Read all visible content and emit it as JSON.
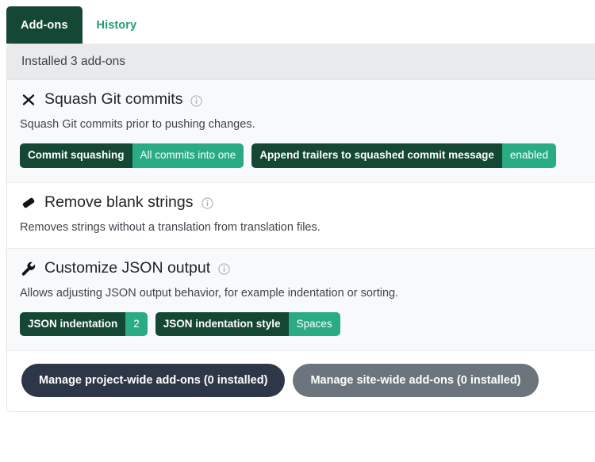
{
  "tabs": [
    {
      "label": "Add-ons",
      "active": true,
      "name": "tab-addons"
    },
    {
      "label": "History",
      "active": false,
      "name": "tab-history"
    }
  ],
  "card": {
    "header": "Installed 3 add-ons"
  },
  "addons": [
    {
      "title": "Squash Git commits",
      "icon": "compress-arrows-icon",
      "info_icon": "info-circle-icon",
      "description": "Squash Git commits prior to pushing changes.",
      "badges": [
        {
          "key": "Commit squashing",
          "value": "All commits into one"
        },
        {
          "key": "Append trailers to squashed commit message",
          "value": "enabled"
        }
      ]
    },
    {
      "title": "Remove blank strings",
      "icon": "eraser-icon",
      "info_icon": "info-circle-icon",
      "description": "Removes strings without a translation from translation files.",
      "badges": []
    },
    {
      "title": "Customize JSON output",
      "icon": "wrench-icon",
      "info_icon": "info-circle-icon",
      "description": "Allows adjusting JSON output behavior, for example indentation or sorting.",
      "badges": [
        {
          "key": "JSON indentation",
          "value": "2"
        },
        {
          "key": "JSON indentation style",
          "value": "Spaces"
        }
      ]
    }
  ],
  "footer": {
    "project_button": "Manage project-wide add-ons (0 installed)",
    "site_button": "Manage site-wide add-ons (0 installed)"
  },
  "colors": {
    "tab_active_bg": "#144734",
    "tab_inactive_text": "#1f9c77",
    "badge_key_bg": "#144734",
    "badge_value_bg": "#2aab83",
    "card_header_bg": "#e9eaec",
    "row_shade_bg": "#f8f9fa",
    "btn_dark_bg": "#2d3748",
    "btn_gray_bg": "#6c757d"
  }
}
